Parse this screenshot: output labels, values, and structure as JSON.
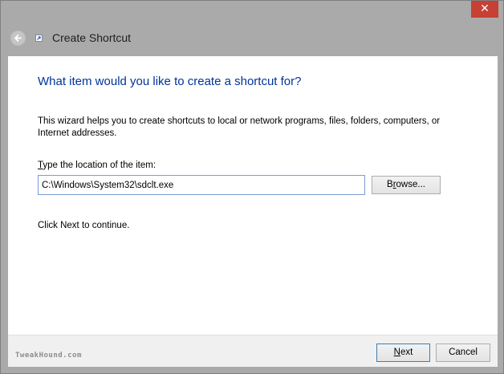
{
  "window": {
    "title": "Create Shortcut",
    "close_glyph": "✕"
  },
  "icons": {
    "back": "back-arrow-icon",
    "shortcut": "shortcut-icon",
    "close": "close-icon"
  },
  "content": {
    "heading": "What item would you like to create a shortcut for?",
    "description": "This wizard helps you to create shortcuts to local or network programs, files, folders, computers, or Internet addresses.",
    "location_label_accel": "T",
    "location_label_rest": "ype the location of the item:",
    "location_value": "C:\\Windows\\System32\\sdclt.exe",
    "browse_accel": "r",
    "browse_pre": "B",
    "browse_post": "owse...",
    "continue_text": "Click Next to continue."
  },
  "footer": {
    "watermark": "TweakHound.com",
    "next_accel": "N",
    "next_rest": "ext",
    "cancel_label": "Cancel"
  },
  "colors": {
    "heading": "#003399",
    "close_button": "#c74034",
    "chrome": "#aaaaaa"
  }
}
